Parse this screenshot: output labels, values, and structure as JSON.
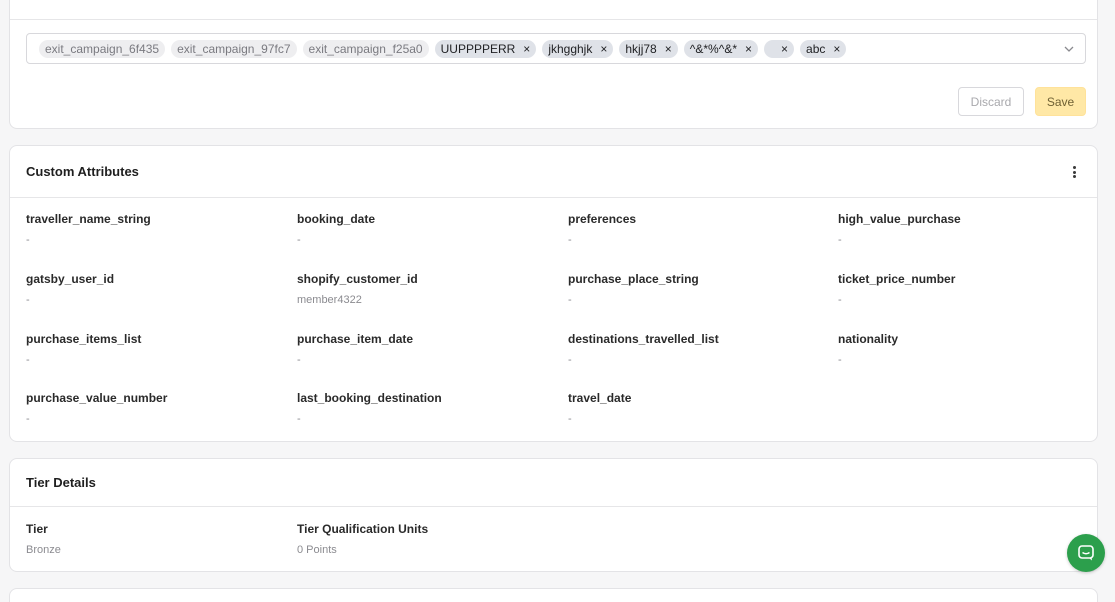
{
  "tags": {
    "system": [
      "exit_campaign_6f435",
      "exit_campaign_97fc7",
      "exit_campaign_f25a0"
    ],
    "custom": [
      "UUPPPPERR",
      "jkhgghjk",
      "hkjj78",
      "^&*%^&*",
      "",
      "abc"
    ],
    "remove_symbol": "×"
  },
  "actions": {
    "discard_label": "Discard",
    "save_label": "Save"
  },
  "custom_attributes": {
    "title": "Custom Attributes",
    "items": [
      {
        "key": "traveller_name_string",
        "value": "-"
      },
      {
        "key": "booking_date",
        "value": "-"
      },
      {
        "key": "preferences",
        "value": "-"
      },
      {
        "key": "high_value_purchase",
        "value": "-"
      },
      {
        "key": "gatsby_user_id",
        "value": "-"
      },
      {
        "key": "shopify_customer_id",
        "value": "member4322"
      },
      {
        "key": "purchase_place_string",
        "value": "-"
      },
      {
        "key": "ticket_price_number",
        "value": "-"
      },
      {
        "key": "purchase_items_list",
        "value": "-"
      },
      {
        "key": "purchase_item_date",
        "value": "-"
      },
      {
        "key": "destinations_travelled_list",
        "value": "-"
      },
      {
        "key": "nationality",
        "value": "-"
      },
      {
        "key": "purchase_value_number",
        "value": "-"
      },
      {
        "key": "last_booking_destination",
        "value": "-"
      },
      {
        "key": "travel_date",
        "value": "-"
      }
    ]
  },
  "tier_details": {
    "title": "Tier Details",
    "tier_label": "Tier",
    "tier_value": "Bronze",
    "units_label": "Tier Qualification Units",
    "units_value": "0 Points"
  },
  "icons": {
    "chevron": "chevron-down-icon",
    "menu": "more-vertical-icon",
    "chat": "chat-icon"
  },
  "colors": {
    "save_bg": "#ffe8a6",
    "chat_bg": "#2c9f4c"
  }
}
